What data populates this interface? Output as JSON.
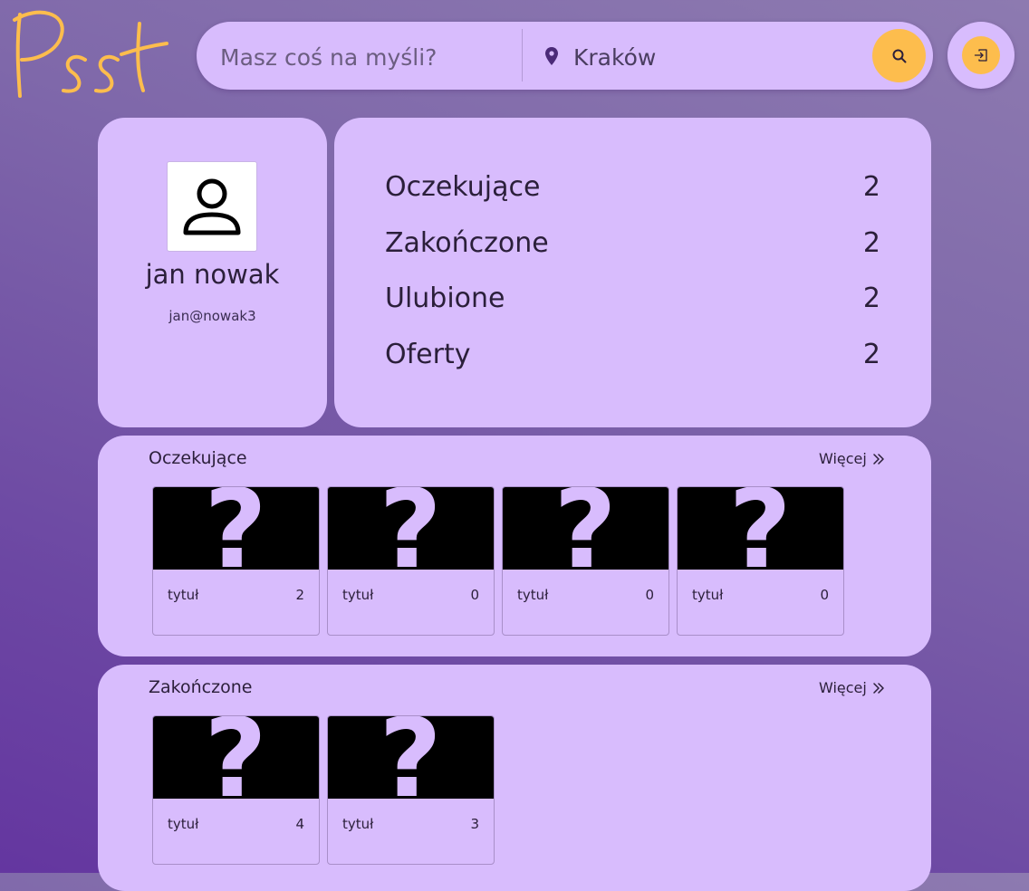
{
  "header": {
    "logo_text": "Psst",
    "search_placeholder": "Masz coś na myśli?",
    "location_placeholder": "Kraków"
  },
  "profile": {
    "name": "jan nowak",
    "email": "jan@nowak3"
  },
  "stats": [
    {
      "label": "Oczekujące",
      "value": "2"
    },
    {
      "label": "Zakończone",
      "value": "2"
    },
    {
      "label": "Ulubione",
      "value": "2"
    },
    {
      "label": "Oferty",
      "value": "2"
    }
  ],
  "sections": [
    {
      "title": "Oczekujące",
      "more_label": "Więcej",
      "items": [
        {
          "title": "tytuł",
          "count": "2"
        },
        {
          "title": "tytuł",
          "count": "0"
        },
        {
          "title": "tytuł",
          "count": "0"
        },
        {
          "title": "tytuł",
          "count": "0"
        }
      ]
    },
    {
      "title": "Zakończone",
      "more_label": "Więcej",
      "items": [
        {
          "title": "tytuł",
          "count": "4"
        },
        {
          "title": "tytuł",
          "count": "3"
        }
      ]
    }
  ],
  "colors": {
    "card": "#d8bcfd",
    "accent": "#fdbd4d",
    "logo": "#fdbd4d",
    "text": "#2b1f3a"
  },
  "icons": {
    "search": "search-icon",
    "login": "login-icon",
    "location": "map-pin-icon",
    "avatar": "user-icon",
    "more": "double-chevron-right-icon",
    "placeholder": "question-mark-icon"
  }
}
